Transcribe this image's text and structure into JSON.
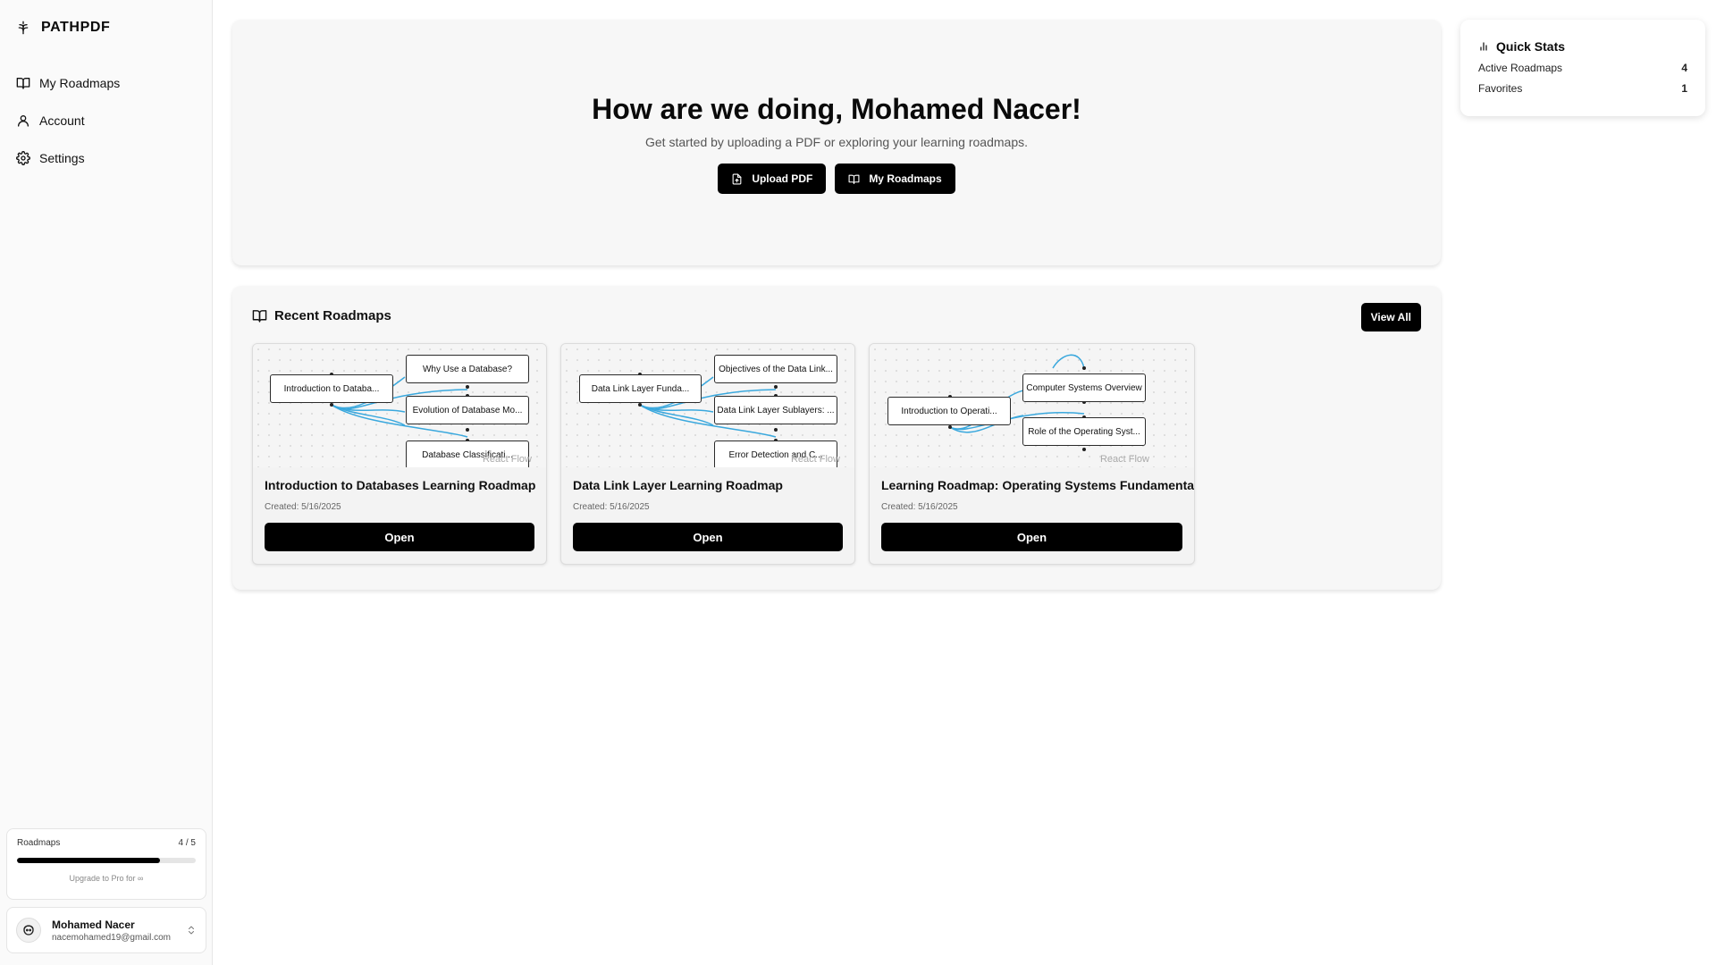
{
  "sidebar": {
    "brand": "PATHPDF",
    "nav": [
      {
        "label": "My Roadmaps",
        "icon": "book-open-icon"
      },
      {
        "label": "Account",
        "icon": "user-icon"
      },
      {
        "label": "Settings",
        "icon": "gear-icon"
      }
    ],
    "usage": {
      "label": "Roadmaps",
      "count": "4 / 5",
      "progress": 0.8,
      "upgrade": "Upgrade to Pro for ∞"
    },
    "user": {
      "name": "Mohamed Nacer",
      "email": "nacemohamed19@gmail.com"
    }
  },
  "hero": {
    "title": "How are we doing, Mohamed Nacer!",
    "subtitle": "Get started by uploading a PDF or exploring your learning roadmaps.",
    "upload_label": "Upload PDF",
    "roadmaps_label": "My Roadmaps"
  },
  "quick_stats": {
    "title": "Quick Stats",
    "rows": [
      {
        "label": "Active Roadmaps",
        "value": "4"
      },
      {
        "label": "Favorites",
        "value": "1"
      }
    ]
  },
  "recent": {
    "title": "Recent Roadmaps",
    "view_all": "View All",
    "cards": [
      {
        "title": "Introduction to Databases Learning Roadmap",
        "created": "Created: 5/16/2025",
        "open_label": "Open",
        "attribution": "React Flow",
        "root_node": "Introduction to Databa...",
        "child_nodes": [
          "Why Use a Database?",
          "Evolution of Database Mo...",
          "Database Classificati..."
        ]
      },
      {
        "title": "Data Link Layer Learning Roadmap",
        "created": "Created: 5/16/2025",
        "open_label": "Open",
        "attribution": "React Flow",
        "root_node": "Data Link Layer Funda...",
        "child_nodes": [
          "Objectives of the Data Link...",
          "Data Link Layer Sublayers: ...",
          "Error Detection and C..."
        ]
      },
      {
        "title": "Learning Roadmap: Operating Systems Fundamentals",
        "created": "Created: 5/16/2025",
        "open_label": "Open",
        "attribution": "React Flow",
        "root_node": "Introduction to Operati...",
        "child_nodes": [
          "Computer Systems Overview",
          "Role of the Operating Syst..."
        ]
      }
    ]
  },
  "colors": {
    "primary": "#000000",
    "edge": "#3aa8dd",
    "panel": "#f7f7f7",
    "sidebar": "#fafafa"
  }
}
